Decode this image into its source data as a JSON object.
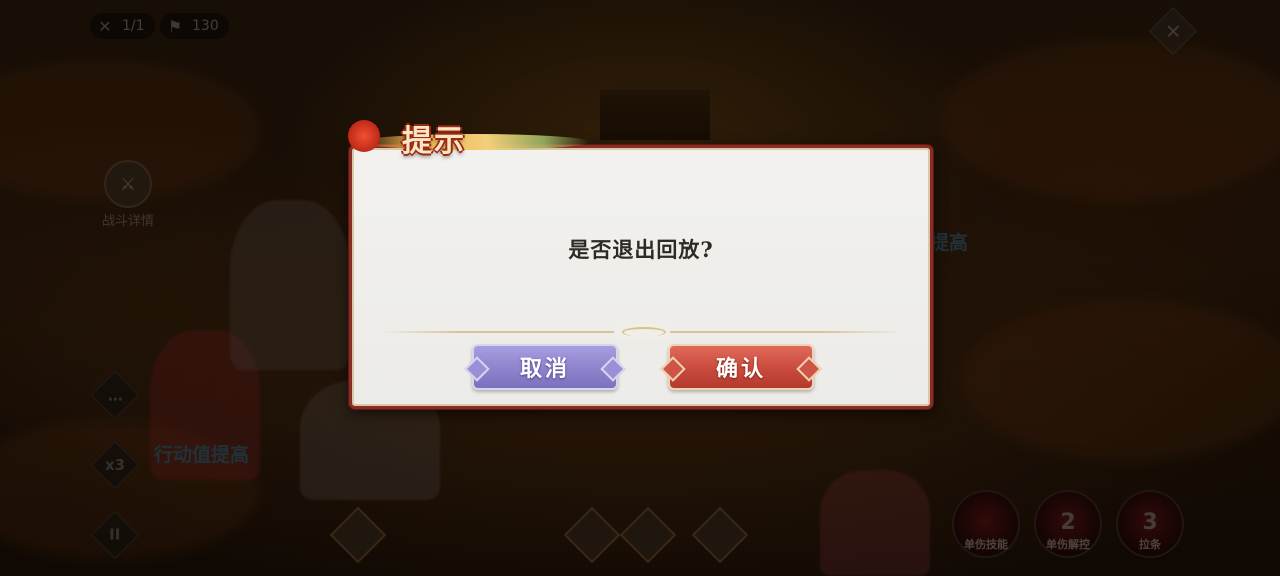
{
  "hud": {
    "round": "1/1",
    "flag_count": "130",
    "round_icon": "crossed-swords-icon",
    "flag_icon": "flag-icon",
    "close_icon": "close-icon"
  },
  "left_panel": {
    "battle_detail_label": "战斗详情",
    "chat_icon": "chat-bubble-icon",
    "speed_label": "x3",
    "pause_label": "II"
  },
  "scene_texts": {
    "action_value_up_left": "行动值提高",
    "action_value_up_right": "提高"
  },
  "skills": [
    {
      "num": "",
      "label": "单伤技能"
    },
    {
      "num": "2",
      "label": "单伤解控"
    },
    {
      "num": "3",
      "label": "拉条"
    }
  ],
  "dialog": {
    "title": "提示",
    "message": "是否退出回放?",
    "cancel_label": "取消",
    "confirm_label": "确认"
  },
  "colors": {
    "dialog_border": "#8b2c24",
    "cancel_button": "#8d82cc",
    "confirm_button": "#c94a3c"
  }
}
